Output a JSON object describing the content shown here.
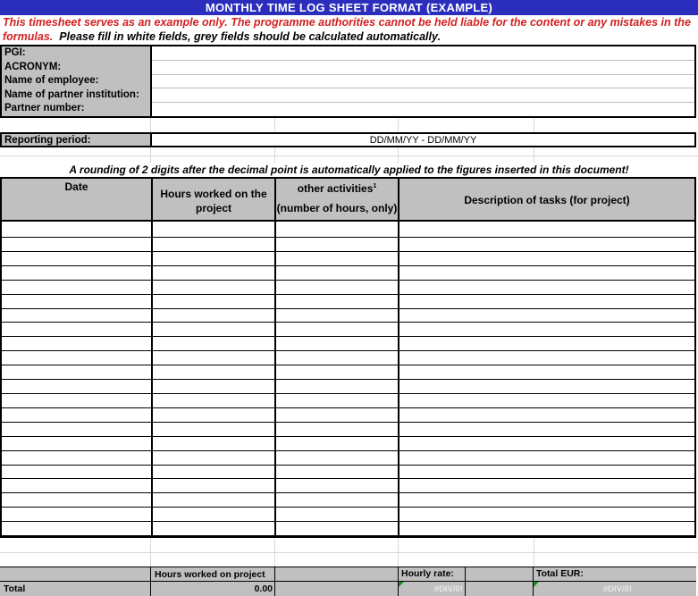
{
  "title": "MONTHLY TIME LOG SHEET FORMAT (EXAMPLE)",
  "disclaimer": {
    "red": "This timesheet serves as an example only. The programme authorities cannot be held liable for the content or any mistakes in the formulas.",
    "black": "Please fill in white fields, grey fields should be calculated automatically."
  },
  "info_fields": [
    "PGI:",
    "ACRONYM:",
    "Name of employee:",
    "Name of partner institution:",
    "Partner number:"
  ],
  "reporting_period": {
    "label": "Reporting period:",
    "value": "DD/MM/YY - DD/MM/YY"
  },
  "rounding_note": "A rounding of 2 digits after the decimal point is automatically applied to the figures inserted in this document!",
  "table": {
    "headers": {
      "date": "Date",
      "hours": "Hours worked on the project",
      "other": "other activities",
      "other_sup": "1",
      "other_sub": "(number of hours, only)",
      "desc": "Description of tasks (for project)"
    },
    "row_count": 22
  },
  "footer": {
    "hours_label": "Hours worked on project",
    "hourly_rate_label": "Hourly rate:",
    "total_eur_label": "Total EUR:",
    "total_label": "Total",
    "hours_value": "0.00",
    "rate_value": "#DIV/0!",
    "total_eur_value": "#DIV/0!"
  },
  "colors": {
    "title_bg": "#2b2ebd",
    "warning_red": "#d42020",
    "grey_fill": "#c0c0c0"
  }
}
